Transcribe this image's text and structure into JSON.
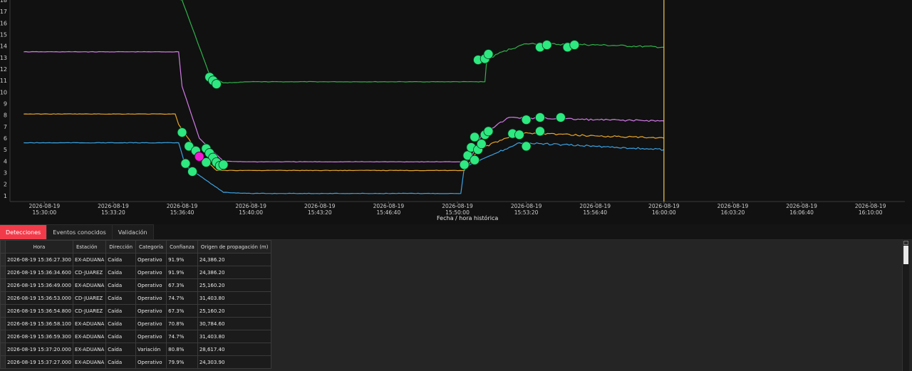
{
  "colors": {
    "green": "#2fb34a",
    "violet": "#d27be8",
    "orange": "#e7a52b",
    "blue": "#3aa3e3",
    "marker_green": "#2ee880",
    "marker_magenta": "#f01ad2",
    "cursor": "#f2c94c",
    "tab_active": "#f23b4a"
  },
  "chart_data": {
    "type": "line",
    "xlabel": "Fecha / hora histórica",
    "ylabel": "",
    "ylim": [
      0.5,
      18
    ],
    "y_ticks": [
      1,
      2,
      3,
      4,
      5,
      6,
      7,
      8,
      9,
      10,
      11,
      12,
      13,
      14,
      15,
      16,
      17,
      18
    ],
    "x_ticks": [
      {
        "date": "2026-08-19",
        "time": "15:30:00"
      },
      {
        "date": "2026-08-19",
        "time": "15:33:20"
      },
      {
        "date": "2026-08-19",
        "time": "15:36:40"
      },
      {
        "date": "2026-08-19",
        "time": "15:40:00"
      },
      {
        "date": "2026-08-19",
        "time": "15:43:20"
      },
      {
        "date": "2026-08-19",
        "time": "15:46:40"
      },
      {
        "date": "2026-08-19",
        "time": "15:50:00"
      },
      {
        "date": "2026-08-19",
        "time": "15:53:20"
      },
      {
        "date": "2026-08-19",
        "time": "15:56:40"
      },
      {
        "date": "2026-08-19",
        "time": "16:00:00"
      },
      {
        "date": "2026-08-19",
        "time": "16:03:20"
      },
      {
        "date": "2026-08-19",
        "time": "16:06:40"
      },
      {
        "date": "2026-08-19",
        "time": "16:10:00"
      }
    ],
    "cursor_time": "16:00:00",
    "series": [
      {
        "color": "#2fb34a",
        "points": [
          [
            "15:29:00",
            19.5
          ],
          [
            "15:36:40",
            18.0
          ],
          [
            "15:38:00",
            11.5
          ],
          [
            "15:38:40",
            10.8
          ],
          [
            "15:40:00",
            10.9
          ],
          [
            "15:51:20",
            10.9
          ],
          [
            "15:51:25",
            12.8
          ],
          [
            "15:52:10",
            13.5
          ],
          [
            "15:53:20",
            14.2
          ],
          [
            "15:56:40",
            14.1
          ],
          [
            "16:00:00",
            13.9
          ]
        ]
      },
      {
        "color": "#d27be8",
        "points": [
          [
            "15:29:00",
            13.5
          ],
          [
            "15:36:30",
            13.5
          ],
          [
            "15:36:40",
            10.5
          ],
          [
            "15:37:30",
            6.0
          ],
          [
            "15:38:40",
            4.0
          ],
          [
            "15:40:00",
            3.95
          ],
          [
            "15:50:20",
            3.95
          ],
          [
            "15:50:40",
            4.3
          ],
          [
            "15:51:10",
            6.3
          ],
          [
            "15:52:30",
            7.8
          ],
          [
            "15:56:40",
            7.6
          ],
          [
            "16:00:00",
            7.5
          ]
        ]
      },
      {
        "color": "#e7a52b",
        "points": [
          [
            "15:29:00",
            8.1
          ],
          [
            "15:36:20",
            8.1
          ],
          [
            "15:36:30",
            7.2
          ],
          [
            "15:37:30",
            4.6
          ],
          [
            "15:38:20",
            3.2
          ],
          [
            "15:40:00",
            3.2
          ],
          [
            "15:50:20",
            3.2
          ],
          [
            "15:51:00",
            5.0
          ],
          [
            "15:53:00",
            6.5
          ],
          [
            "15:56:40",
            6.2
          ],
          [
            "16:00:00",
            6.0
          ]
        ]
      },
      {
        "color": "#3aa3e3",
        "points": [
          [
            "15:29:00",
            5.6
          ],
          [
            "15:36:30",
            5.6
          ],
          [
            "15:36:50",
            3.6
          ],
          [
            "15:38:40",
            1.3
          ],
          [
            "15:40:00",
            1.2
          ],
          [
            "15:50:10",
            1.2
          ],
          [
            "15:50:20",
            3.5
          ],
          [
            "15:52:00",
            4.8
          ],
          [
            "15:53:00",
            5.6
          ],
          [
            "15:56:40",
            5.3
          ],
          [
            "16:00:00",
            5.0
          ]
        ]
      }
    ],
    "markers": [
      {
        "t": "15:38:00",
        "y": 11.3
      },
      {
        "t": "15:38:10",
        "y": 11.0
      },
      {
        "t": "15:38:20",
        "y": 10.7
      },
      {
        "t": "15:36:40",
        "y": 6.5
      },
      {
        "t": "15:37:00",
        "y": 5.3
      },
      {
        "t": "15:37:20",
        "y": 4.9
      },
      {
        "t": "15:37:50",
        "y": 5.1
      },
      {
        "t": "15:38:00",
        "y": 4.7
      },
      {
        "t": "15:38:10",
        "y": 4.3
      },
      {
        "t": "15:38:20",
        "y": 3.9
      },
      {
        "t": "15:38:30",
        "y": 3.6
      },
      {
        "t": "15:36:50",
        "y": 3.8
      },
      {
        "t": "15:37:10",
        "y": 3.1
      },
      {
        "t": "15:37:50",
        "y": 3.9
      },
      {
        "t": "15:38:40",
        "y": 3.7
      },
      {
        "t": "15:51:00",
        "y": 12.8
      },
      {
        "t": "15:51:20",
        "y": 12.9
      },
      {
        "t": "15:51:30",
        "y": 13.3
      },
      {
        "t": "15:54:00",
        "y": 13.9
      },
      {
        "t": "15:54:20",
        "y": 14.1
      },
      {
        "t": "15:55:20",
        "y": 13.9
      },
      {
        "t": "15:55:40",
        "y": 14.1
      },
      {
        "t": "15:50:20",
        "y": 3.7
      },
      {
        "t": "15:50:30",
        "y": 4.5
      },
      {
        "t": "15:50:40",
        "y": 5.2
      },
      {
        "t": "15:50:50",
        "y": 6.1
      },
      {
        "t": "15:51:00",
        "y": 5.0
      },
      {
        "t": "15:51:10",
        "y": 5.5
      },
      {
        "t": "15:51:20",
        "y": 6.3
      },
      {
        "t": "15:51:30",
        "y": 6.6
      },
      {
        "t": "15:50:50",
        "y": 4.1
      },
      {
        "t": "15:52:40",
        "y": 6.4
      },
      {
        "t": "15:53:00",
        "y": 6.3
      },
      {
        "t": "15:53:20",
        "y": 5.3
      },
      {
        "t": "15:53:20",
        "y": 7.6
      },
      {
        "t": "15:54:00",
        "y": 7.8
      },
      {
        "t": "15:55:00",
        "y": 7.8
      },
      {
        "t": "15:54:00",
        "y": 6.6
      }
    ],
    "highlight_marker": {
      "t": "15:37:30",
      "y": 4.4
    }
  },
  "tabs": [
    {
      "label": "Detecciones",
      "active": true
    },
    {
      "label": "Eventos conocidos",
      "active": false
    },
    {
      "label": "Validación",
      "active": false
    }
  ],
  "table": {
    "columns": [
      "Hora",
      "Estación",
      "Dirección",
      "Categoría",
      "Confianza",
      "Origen de propagación (m)"
    ],
    "rows": [
      [
        "2026-08-19 15:36:27.300",
        "EX-ADUANA",
        "Caída",
        "Operativo",
        "91.9%",
        "24,386.20"
      ],
      [
        "2026-08-19 15:36:34.600",
        "CD-JUAREZ",
        "Caída",
        "Operativo",
        "91.9%",
        "24,386.20"
      ],
      [
        "2026-08-19 15:36:49.000",
        "EX-ADUANA",
        "Caída",
        "Operativo",
        "67.3%",
        "25,160.20"
      ],
      [
        "2026-08-19 15:36:53.000",
        "CD-JUAREZ",
        "Caída",
        "Operativo",
        "74.7%",
        "31,403.80"
      ],
      [
        "2026-08-19 15:36:54.800",
        "CD-JUAREZ",
        "Caída",
        "Operativo",
        "67.3%",
        "25,160.20"
      ],
      [
        "2026-08-19 15:36:58.100",
        "EX-ADUANA",
        "Caída",
        "Operativo",
        "70.8%",
        "30,784.60"
      ],
      [
        "2026-08-19 15:36:59.300",
        "EX-ADUANA",
        "Caída",
        "Operativo",
        "74.7%",
        "31,403.80"
      ],
      [
        "2026-08-19 15:37:20.000",
        "EX-ADUANA",
        "Caída",
        "Variación",
        "80.8%",
        "28,617.40"
      ],
      [
        "2026-08-19 15:37:27.000",
        "EX-ADUANA",
        "Caída",
        "Operativo",
        "79.9%",
        "24,303.90"
      ]
    ]
  }
}
